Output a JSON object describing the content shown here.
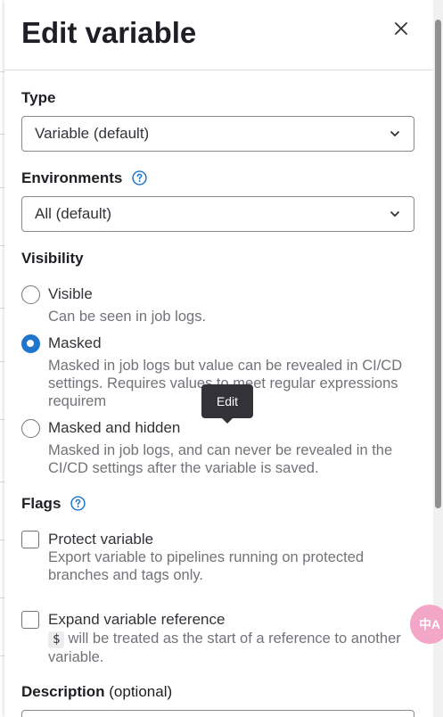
{
  "drawer": {
    "title": "Edit variable",
    "close_label": "×"
  },
  "type_field": {
    "label": "Type",
    "value": "Variable (default)"
  },
  "environments_field": {
    "label": "Environments",
    "value": "All (default)"
  },
  "visibility": {
    "label": "Visibility",
    "options": [
      {
        "label": "Visible",
        "help": "Can be seen in job logs.",
        "checked": false
      },
      {
        "label": "Masked",
        "help": "Masked in job logs but value can be revealed in CI/CD settings. Requires values to meet regular expressions requirem",
        "checked": true
      },
      {
        "label": "Masked and hidden",
        "help": "Masked in job logs, and can never be revealed in the CI/CD settings after the variable is saved.",
        "checked": false
      }
    ]
  },
  "tooltip": {
    "text": "Edit"
  },
  "flags": {
    "label": "Flags",
    "items": [
      {
        "label": "Protect variable",
        "help": "Export variable to pipelines running on protected branches and tags only.",
        "checked": false
      },
      {
        "label": "Expand variable reference",
        "code": "$",
        "help": "will be treated as the start of a reference to another variable.",
        "checked": false
      }
    ]
  },
  "description": {
    "label": "Description",
    "optional": "(optional)"
  },
  "translate_fab": {
    "text": "中A"
  },
  "colors": {
    "accent": "#1f75cb",
    "text": "#333238",
    "muted": "#737278"
  }
}
